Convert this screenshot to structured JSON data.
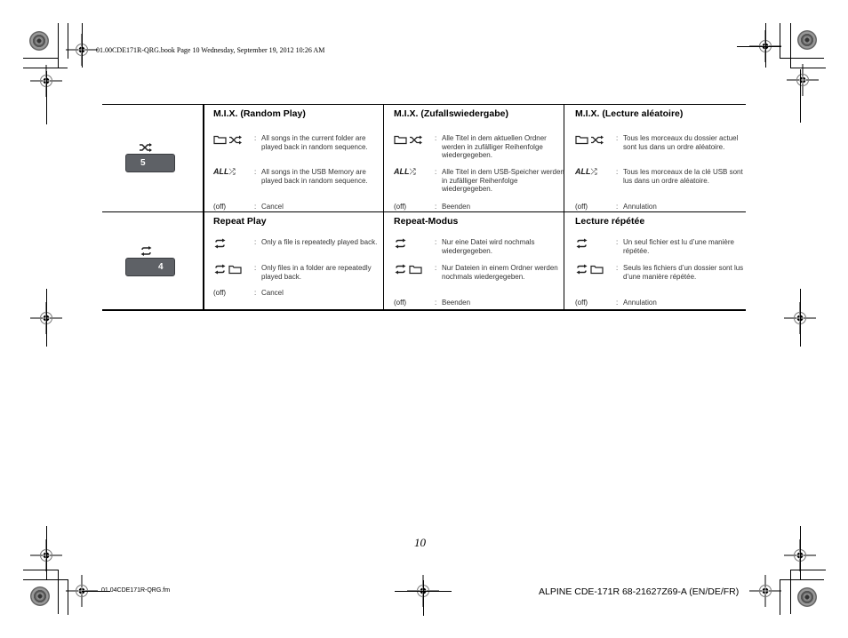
{
  "header": {
    "slug": "01.00CDE171R-QRG.book  Page 10  Wednesday, September 19, 2012  10:26 AM"
  },
  "footer": {
    "file_name": "01.04CDE171R-QRG.fm",
    "page_number": "10",
    "product_code": "ALPINE CDE-171R 68-21627Z69-A (EN/DE/FR)"
  },
  "colors": {
    "button_fill": "#5e6166",
    "text": "#1a1a1a"
  },
  "rows": [
    {
      "button": {
        "label": "5",
        "icon": "shuffle-icon"
      },
      "columns": [
        {
          "title": "M.I.X.  (Random Play)",
          "entries": [
            {
              "symbol": "folder-shuffle-icon",
              "description": "All songs in the current folder are played back in random sequence."
            },
            {
              "symbol": "all-shuffle-icon",
              "symbol_text": "ALL",
              "description": "All songs in the USB Memory are played back in random sequence."
            }
          ],
          "off_label": "(off)",
          "off_description": "Cancel"
        },
        {
          "title": "M.I.X. (Zufallswiedergabe)",
          "entries": [
            {
              "symbol": "folder-shuffle-icon",
              "description": "Alle Titel in dem aktuellen Ordner werden in zufälliger Reihenfolge wiedergegeben."
            },
            {
              "symbol": "all-shuffle-icon",
              "symbol_text": "ALL",
              "description": "Alle Titel in dem USB-Speicher werden in zufälliger Reihenfolge wiedergegeben."
            }
          ],
          "off_label": "(off)",
          "off_description": "Beenden"
        },
        {
          "title": "M.I.X.  (Lecture aléatoire)",
          "entries": [
            {
              "symbol": "folder-shuffle-icon",
              "description": "Tous les morceaux du dossier actuel sont lus dans un ordre aléatoire."
            },
            {
              "symbol": "all-shuffle-icon",
              "symbol_text": "ALL",
              "description": "Tous les morceaux de la clé USB sont lus dans un ordre aléatoire."
            }
          ],
          "off_label": "(off)",
          "off_description": "Annulation"
        }
      ]
    },
    {
      "button": {
        "label": "4",
        "icon": "repeat-icon"
      },
      "columns": [
        {
          "title": "Repeat Play",
          "entries": [
            {
              "symbol": "repeat-icon",
              "description": "Only a file is repeatedly played back."
            },
            {
              "symbol": "repeat-folder-icon",
              "description": "Only files in a folder are repeatedly played back."
            }
          ],
          "off_label": "(off)",
          "off_description": "Cancel"
        },
        {
          "title": "Repeat-Modus",
          "entries": [
            {
              "symbol": "repeat-icon",
              "description": "Nur eine Datei wird nochmals wiedergegeben."
            },
            {
              "symbol": "repeat-folder-icon",
              "description": "Nur Dateien in einem Ordner werden nochmals wiedergegeben."
            }
          ],
          "off_label": "(off)",
          "off_description": "Beenden"
        },
        {
          "title": "Lecture répétée",
          "entries": [
            {
              "symbol": "repeat-icon",
              "description": "Un seul fichier est lu d’une manière répétée."
            },
            {
              "symbol": "repeat-folder-icon",
              "description": "Seuls les fichiers d’un dossier sont lus d’une manière répétée."
            }
          ],
          "off_label": "(off)",
          "off_description": "Annulation"
        }
      ]
    }
  ]
}
